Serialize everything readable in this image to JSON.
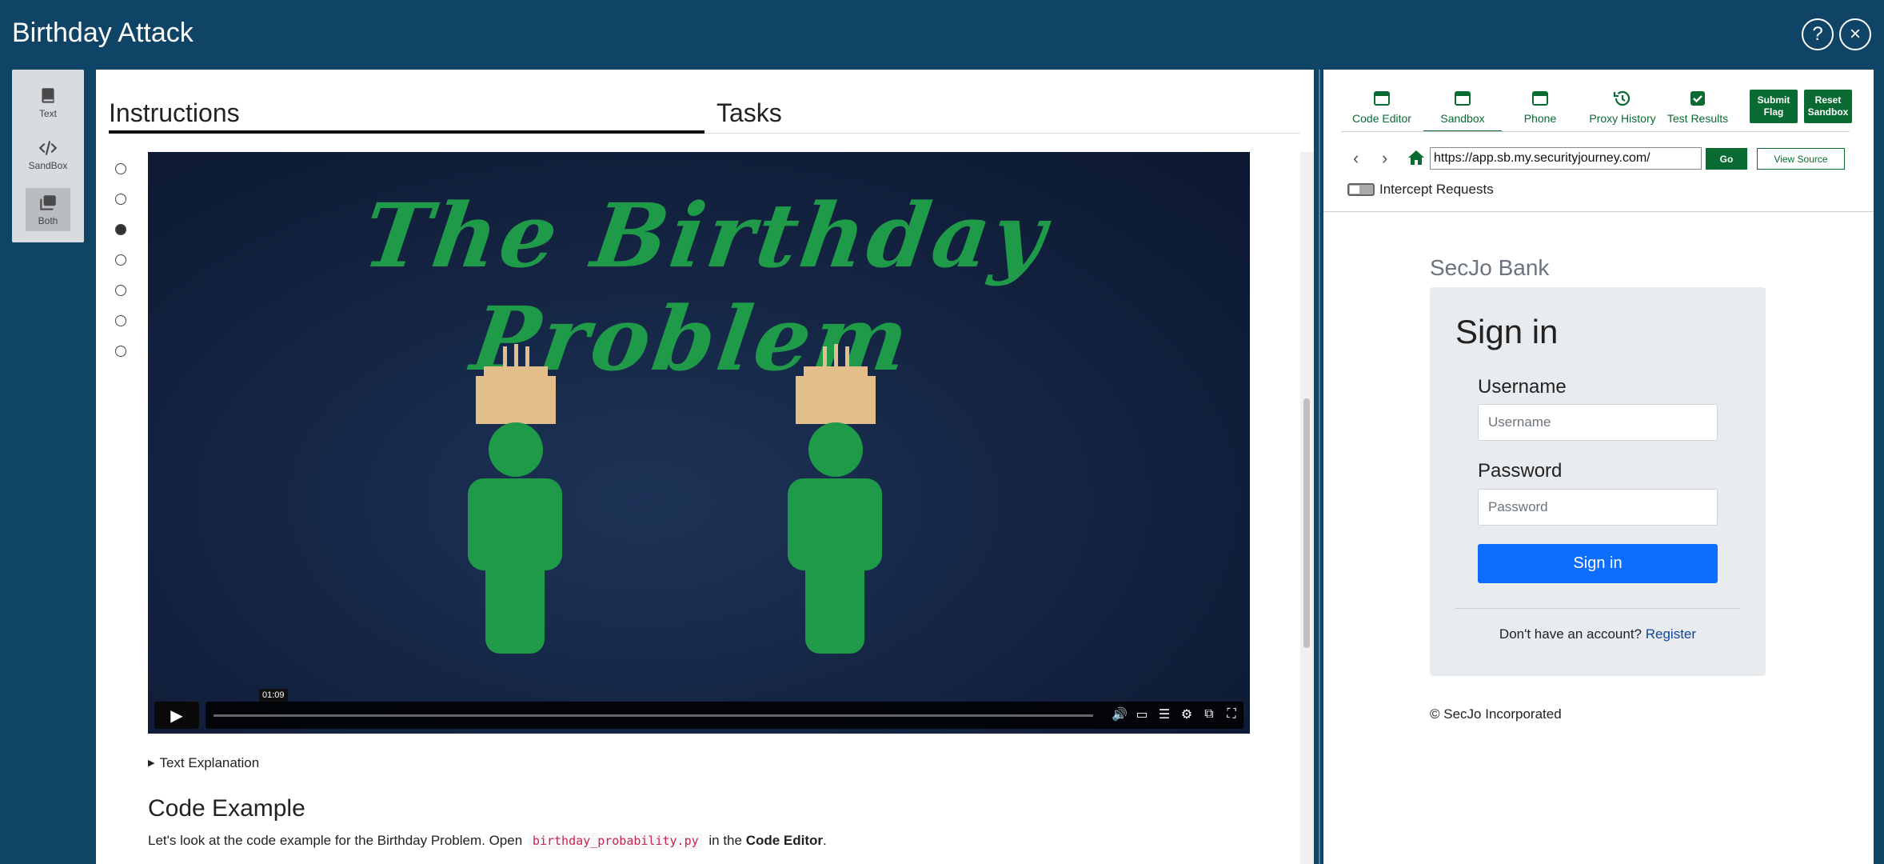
{
  "app": {
    "title": "Birthday Attack",
    "help_label": "?",
    "close_label": "×"
  },
  "mode_rail": {
    "items": [
      {
        "label": "Text",
        "icon": "book-icon"
      },
      {
        "label": "SandBox",
        "icon": "code-icon"
      },
      {
        "label": "Both",
        "icon": "stacked-copies-icon",
        "active": true
      }
    ]
  },
  "main": {
    "tabs": [
      {
        "label": "Instructions",
        "active": true
      },
      {
        "label": "Tasks",
        "active": false
      }
    ],
    "steps": [
      false,
      false,
      true,
      false,
      false,
      false,
      false
    ],
    "video": {
      "title": "The Birthday Problem",
      "time_tooltip": "01:09",
      "progress": 0.0
    },
    "text_explanation": "Text Explanation",
    "code_heading": "Code Example",
    "code_para": {
      "before": "Let's look at the code example for the Birthday Problem. Open",
      "code": "birthday_probability.py",
      "middle": "in the",
      "bold": "Code Editor",
      "after": "."
    }
  },
  "sandbox": {
    "tabs": [
      {
        "label": "Code Editor",
        "icon": "window-icon"
      },
      {
        "label": "Sandbox",
        "icon": "window-icon",
        "active": true
      },
      {
        "label": "Phone",
        "icon": "window-icon"
      },
      {
        "label": "Proxy History",
        "icon": "history-icon"
      },
      {
        "label": "Test Results",
        "icon": "check-box-icon"
      }
    ],
    "submit_flag": "Submit Flag",
    "reset_sandbox": "Reset Sandbox",
    "url": "https://app.sb.my.securityjourney.com/",
    "go_label": "Go",
    "view_source": "View Source",
    "intercept_label": "Intercept Requests",
    "colors": {
      "accent": "#0a6b32",
      "primary_blue": "#0d6efd"
    }
  },
  "site": {
    "bank_name": "SecJo Bank",
    "card_title": "Sign in",
    "username_label": "Username",
    "username_placeholder": "Username",
    "password_label": "Password",
    "password_placeholder": "Password",
    "signin_button": "Sign in",
    "no_account": "Don't have an account?",
    "register_link": "Register",
    "copyright": "© SecJo Incorporated"
  }
}
